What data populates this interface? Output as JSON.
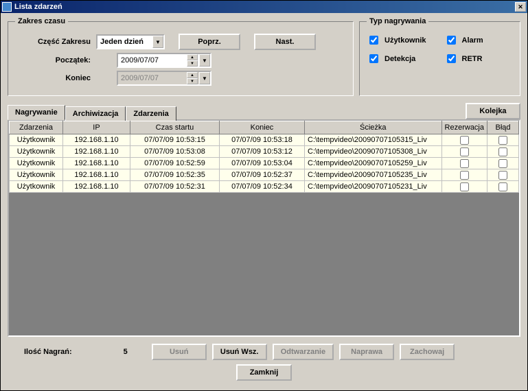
{
  "window": {
    "title": "Lista zdarzeń"
  },
  "timeRange": {
    "legend": "Zakres czasu",
    "rangeLabel": "Część Zakresu",
    "rangeValue": "Jeden dzień",
    "prevBtn": "Poprz.",
    "nextBtn": "Nast.",
    "startLabel": "Początek:",
    "startValue": "2009/07/07",
    "endLabel": "Koniec",
    "endValue": "2009/07/07"
  },
  "recType": {
    "legend": "Typ nagrywania",
    "user": "Użytkownik",
    "alarm": "Alarm",
    "detect": "Detekcja",
    "retr": "RETR"
  },
  "tabs": {
    "recording": "Nagrywanie",
    "archiving": "Archiwizacja",
    "events": "Zdarzenia",
    "queueBtn": "Kolejka"
  },
  "table": {
    "headers": {
      "event": "Zdarzenia",
      "ip": "IP",
      "start": "Czas startu",
      "end": "Koniec",
      "path": "Ścieżka",
      "reserve": "Rezerwacja",
      "error": "Błąd"
    },
    "rows": [
      {
        "event": "Użytkownik",
        "ip": "192.168.1.10",
        "start": "07/07/09 10:53:15",
        "end": "07/07/09 10:53:18",
        "path": "C:\\tempvideo\\20090707105315_Liv"
      },
      {
        "event": "Użytkownik",
        "ip": "192.168.1.10",
        "start": "07/07/09 10:53:08",
        "end": "07/07/09 10:53:12",
        "path": "C:\\tempvideo\\20090707105308_Liv"
      },
      {
        "event": "Użytkownik",
        "ip": "192.168.1.10",
        "start": "07/07/09 10:52:59",
        "end": "07/07/09 10:53:04",
        "path": "C:\\tempvideo\\20090707105259_Liv"
      },
      {
        "event": "Użytkownik",
        "ip": "192.168.1.10",
        "start": "07/07/09 10:52:35",
        "end": "07/07/09 10:52:37",
        "path": "C:\\tempvideo\\20090707105235_Liv"
      },
      {
        "event": "Użytkownik",
        "ip": "192.168.1.10",
        "start": "07/07/09 10:52:31",
        "end": "07/07/09 10:52:34",
        "path": "C:\\tempvideo\\20090707105231_Liv"
      }
    ]
  },
  "bottom": {
    "countLabel": "Ilość Nagrań:",
    "countValue": "5",
    "delete": "Usuń",
    "deleteAll": "Usuń Wsz.",
    "play": "Odtwarzanie",
    "repair": "Naprawa",
    "save": "Zachowaj",
    "close": "Zamknij"
  }
}
